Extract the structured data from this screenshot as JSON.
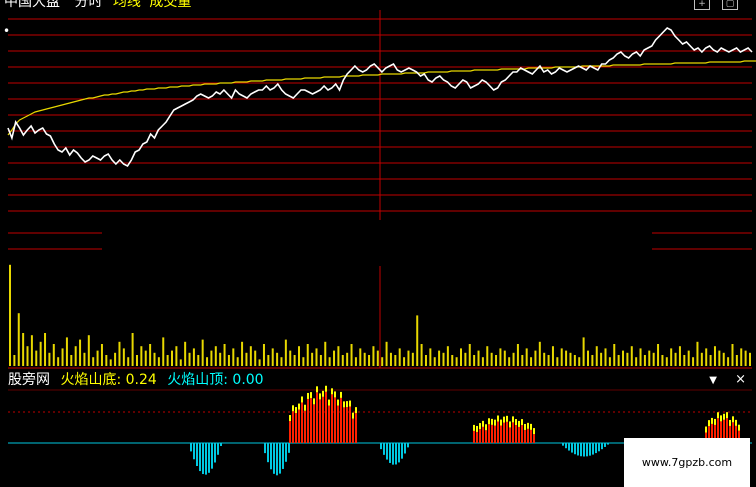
{
  "header": {
    "stock_name": "中国大盘",
    "view": "分时",
    "avg_line_label": "均线",
    "volume_label": "成交量",
    "dot_label": "•"
  },
  "indicator": {
    "source": "股旁网",
    "bottom_label": "火焰山底:",
    "bottom_value": "0.24",
    "top_label": "火焰山顶:",
    "top_value": "0.00",
    "dropdown_icon": "chevron-down-icon",
    "close_icon": "close-icon",
    "menu_glyph": "▼",
    "close_glyph": "×"
  },
  "toolbar": {
    "expand_glyph": "+",
    "restore_glyph": "▢"
  },
  "watermark": {
    "text": "www.7gpzb.com"
  },
  "colors": {
    "background": "#000000",
    "price_line": "#ffffff",
    "avg_line": "#e8d800",
    "grid": "#c00000",
    "volume": "#e8d800",
    "flame_top": "#ffff00",
    "flame_bottom": "#ff2000",
    "cyan_bars": "#00c8e0"
  },
  "chart_data": {
    "type": "line",
    "price": [
      118,
      128,
      112,
      118,
      125,
      120,
      116,
      123,
      120,
      118,
      124,
      126,
      134,
      140,
      142,
      138,
      145,
      140,
      143,
      148,
      152,
      150,
      146,
      148,
      150,
      146,
      144,
      150,
      154,
      150,
      154,
      156,
      150,
      142,
      140,
      134,
      132,
      124,
      128,
      120,
      116,
      112,
      106,
      100,
      98,
      96,
      94,
      92,
      90,
      86,
      84,
      86,
      88,
      86,
      82,
      84,
      80,
      84,
      88,
      80,
      84,
      86,
      88,
      84,
      82,
      80,
      80,
      76,
      80,
      78,
      74,
      80,
      84,
      86,
      88,
      84,
      80,
      80,
      82,
      84,
      82,
      80,
      76,
      80,
      78,
      74,
      80,
      70,
      64,
      60,
      56,
      60,
      62,
      60,
      56,
      54,
      58,
      62,
      58,
      56,
      54,
      60,
      62,
      60,
      58,
      60,
      62,
      66,
      64,
      70,
      72,
      68,
      66,
      70,
      72,
      76,
      78,
      74,
      70,
      72,
      78,
      76,
      74,
      70,
      72,
      76,
      80,
      78,
      72,
      70,
      66,
      62,
      62,
      58,
      60,
      62,
      64,
      60,
      56,
      62,
      60,
      64,
      62,
      58,
      60,
      62,
      60,
      58,
      56,
      58,
      60,
      56,
      58,
      60,
      54,
      54,
      50,
      48,
      44,
      42,
      46,
      48,
      44,
      42,
      46,
      40,
      38,
      36,
      30,
      26,
      22,
      18,
      20,
      26,
      30,
      34,
      32,
      36,
      40,
      38,
      42,
      38,
      36,
      40,
      42,
      38,
      40,
      42,
      40,
      38,
      42,
      40,
      38,
      42
    ],
    "avg": [
      125,
      120,
      114,
      110,
      108,
      106,
      104,
      102,
      101,
      100,
      99,
      98,
      97,
      96,
      95,
      94,
      93,
      92,
      91,
      90,
      89,
      88,
      88,
      87,
      86,
      85,
      85,
      84,
      84,
      83,
      82,
      82,
      81,
      81,
      80,
      80,
      79,
      79,
      79,
      78,
      78,
      78,
      77,
      77,
      77,
      76,
      76,
      76,
      75,
      75,
      75,
      74,
      74,
      74,
      74,
      73,
      73,
      73,
      73,
      72,
      72,
      72,
      72,
      71,
      71,
      71,
      71,
      70,
      70,
      70,
      70,
      70,
      69,
      69,
      69,
      69,
      69,
      68,
      68,
      68,
      68,
      68,
      67,
      67,
      67,
      67,
      67,
      66,
      66,
      66,
      66,
      66,
      65,
      65,
      65,
      65,
      65,
      64,
      64,
      64,
      64,
      64,
      64,
      63,
      63,
      63,
      63,
      63,
      63,
      62,
      62,
      62,
      62,
      62,
      62,
      61,
      61,
      61,
      61,
      61,
      61,
      60,
      60,
      60,
      60,
      60,
      60,
      60,
      59,
      59,
      59,
      59,
      59,
      59,
      59,
      58,
      58,
      58,
      58,
      58,
      58,
      58,
      57,
      57,
      57,
      57,
      57,
      57,
      57,
      56,
      56,
      56,
      56,
      56,
      56,
      56,
      56,
      55,
      55,
      55,
      55,
      55,
      55,
      55,
      55,
      54,
      54,
      54,
      54,
      54,
      54,
      54,
      54,
      53,
      53,
      53,
      53,
      53,
      53,
      53,
      53,
      53,
      52,
      52,
      52,
      52,
      52,
      52,
      52,
      52,
      52,
      51,
      51,
      51,
      51,
      51
    ],
    "volume": [
      92,
      10,
      48,
      30,
      18,
      28,
      14,
      22,
      30,
      12,
      20,
      8,
      16,
      26,
      10,
      18,
      24,
      12,
      28,
      8,
      14,
      20,
      10,
      6,
      12,
      22,
      16,
      8,
      30,
      10,
      18,
      14,
      20,
      12,
      8,
      26,
      10,
      14,
      18,
      6,
      22,
      12,
      16,
      10,
      24,
      8,
      14,
      18,
      12,
      20,
      10,
      16,
      8,
      22,
      12,
      18,
      14,
      6,
      20,
      10,
      16,
      12,
      8,
      24,
      14,
      10,
      18,
      8,
      20,
      12,
      16,
      10,
      22,
      8,
      14,
      18,
      10,
      12,
      20,
      8,
      16,
      12,
      10,
      18,
      14,
      8,
      22,
      12,
      10,
      16,
      8,
      14,
      12,
      46,
      20,
      10,
      16,
      8,
      14,
      12,
      18,
      10,
      8,
      16,
      12,
      20,
      10,
      14,
      8,
      18,
      12,
      10,
      16,
      14,
      8,
      12,
      20,
      10,
      16,
      8,
      14,
      22,
      12,
      10,
      18,
      8,
      16,
      14,
      12,
      10,
      8,
      26,
      14,
      10,
      18,
      12,
      16,
      8,
      20,
      10,
      14,
      12,
      18,
      8,
      16,
      10,
      14,
      12,
      20,
      10,
      8,
      16,
      12,
      18,
      10,
      14,
      8,
      22,
      12,
      16,
      10,
      18,
      14,
      12,
      8,
      20,
      10,
      16,
      14,
      12
    ],
    "flame": [
      0,
      0,
      0,
      0,
      0,
      0,
      0,
      0,
      0,
      0,
      0,
      0,
      0,
      0,
      0,
      0,
      0,
      0,
      0,
      0,
      0,
      0,
      0,
      0,
      0,
      0,
      0,
      0,
      0,
      0,
      0,
      0,
      0,
      0,
      0,
      0,
      0,
      0,
      0,
      0,
      0,
      0,
      0,
      0,
      0,
      0,
      0,
      0,
      0,
      0,
      0,
      0,
      0,
      0,
      0,
      0,
      0,
      0,
      0,
      0,
      0,
      0,
      0,
      0,
      0,
      0,
      0,
      0,
      0,
      0,
      0,
      0,
      0,
      0,
      0,
      0,
      0,
      0,
      0,
      0,
      0,
      0,
      0,
      0,
      0,
      0,
      0,
      0,
      0,
      0,
      0,
      0,
      0,
      0,
      0,
      0,
      0,
      0,
      0,
      0,
      0,
      0,
      0,
      0,
      0,
      0,
      0,
      0,
      0,
      0,
      0,
      0,
      0,
      0,
      0,
      0,
      0,
      0,
      0,
      0,
      0,
      0,
      0,
      0,
      0,
      0,
      0,
      0,
      0,
      0,
      0,
      0,
      0,
      0,
      0,
      0,
      0,
      0,
      0,
      0,
      0,
      0,
      0,
      0,
      0,
      0,
      0,
      0,
      0,
      0,
      0,
      0,
      0,
      0,
      0,
      0,
      0,
      0,
      0,
      0,
      0,
      0,
      0,
      0,
      0,
      0,
      0,
      0,
      0,
      0,
      0,
      0,
      0,
      0,
      0,
      0,
      0,
      0,
      0,
      0,
      0,
      0,
      0,
      0,
      0,
      0,
      0,
      0,
      0,
      0,
      0,
      0,
      0,
      0,
      0,
      0,
      0,
      0,
      0,
      0
    ],
    "cyan": [
      0,
      0,
      0,
      0,
      0,
      0,
      0,
      0,
      0,
      0,
      0,
      0,
      0,
      0,
      0,
      0,
      0,
      0,
      0,
      0,
      0,
      0,
      0,
      0,
      0,
      0,
      0,
      0,
      0,
      0,
      0,
      0,
      0,
      0,
      0,
      0,
      0,
      0,
      0,
      0,
      0,
      0,
      0,
      0,
      0,
      0,
      0,
      0,
      0,
      0,
      0,
      0,
      0,
      0,
      0,
      0,
      0,
      0,
      0,
      0,
      0,
      0,
      0,
      0,
      0,
      0,
      0,
      0,
      0,
      0,
      0,
      0,
      0,
      0,
      0,
      0,
      0,
      0,
      0,
      0,
      0,
      0,
      0,
      0,
      0,
      0,
      0,
      0,
      0,
      0,
      0,
      0,
      0,
      0,
      0,
      0,
      0,
      0,
      0,
      0,
      0,
      0,
      0,
      0,
      0,
      0,
      0,
      0,
      0,
      0,
      0,
      0,
      0,
      0,
      0,
      0,
      0,
      0,
      0,
      0,
      0,
      0,
      0,
      0,
      0,
      0,
      0,
      0,
      0,
      0,
      0,
      0,
      0,
      0,
      0,
      0,
      0,
      0,
      0,
      0,
      0,
      0,
      0,
      0,
      0,
      0,
      0,
      0,
      0,
      0,
      0,
      0,
      0,
      0,
      0,
      0,
      0,
      0,
      0,
      0,
      0,
      0,
      0,
      0,
      0,
      0,
      0,
      0,
      0,
      0,
      0,
      0,
      0,
      0,
      0,
      0,
      0,
      0,
      0,
      0,
      0,
      0,
      0,
      0,
      0,
      0,
      0,
      0,
      0,
      0,
      0,
      0,
      0,
      0,
      0,
      0,
      0,
      0,
      0,
      0
    ]
  }
}
